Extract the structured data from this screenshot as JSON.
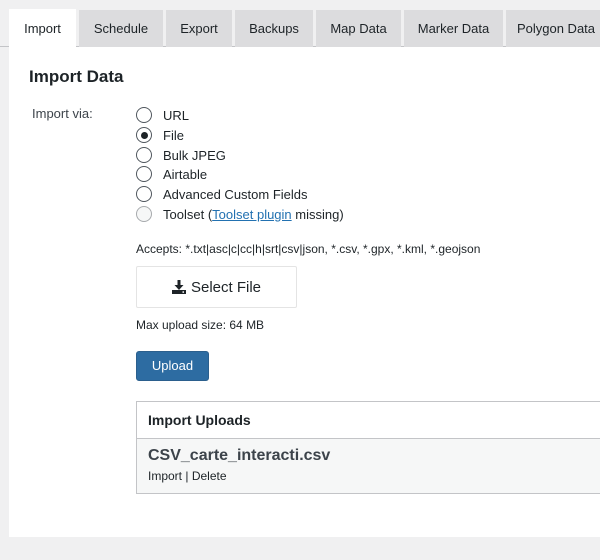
{
  "tabs": [
    {
      "label": "Import",
      "active": true
    },
    {
      "label": "Schedule"
    },
    {
      "label": "Export"
    },
    {
      "label": "Backups"
    },
    {
      "label": "Map Data"
    },
    {
      "label": "Marker Data"
    },
    {
      "label": "Polygon Data"
    }
  ],
  "panel": {
    "heading": "Import Data",
    "import_via_label": "Import via:",
    "options": [
      {
        "label": "URL",
        "checked": false
      },
      {
        "label": "File",
        "checked": true
      },
      {
        "label": "Bulk JPEG",
        "checked": false
      },
      {
        "label": "Airtable",
        "checked": false
      },
      {
        "label": "Advanced Custom Fields",
        "checked": false
      },
      {
        "label": "Toolset",
        "disabled": true,
        "paren_open": " (",
        "link": "Toolset plugin",
        "suffix": " missing)"
      }
    ],
    "accepts": "Accepts: *.txt|asc|c|cc|h|srt|csv|json, *.csv, *.gpx, *.kml, *.geojson",
    "select_file_label": "Select File",
    "upload_icon": "upload-icon",
    "max_upload": "Max upload size: 64 MB",
    "upload_button": "Upload"
  },
  "uploads": {
    "header": "Import Uploads",
    "file": {
      "name": "CSV_carte_interacti.csv",
      "import_label": "Import",
      "separator": " | ",
      "delete_label": "Delete"
    }
  },
  "colors": {
    "accent": "#2271b1",
    "button_bg": "#2d6ca2",
    "tab_inactive": "#dcdcde",
    "page_bg": "#f0f0f1"
  }
}
